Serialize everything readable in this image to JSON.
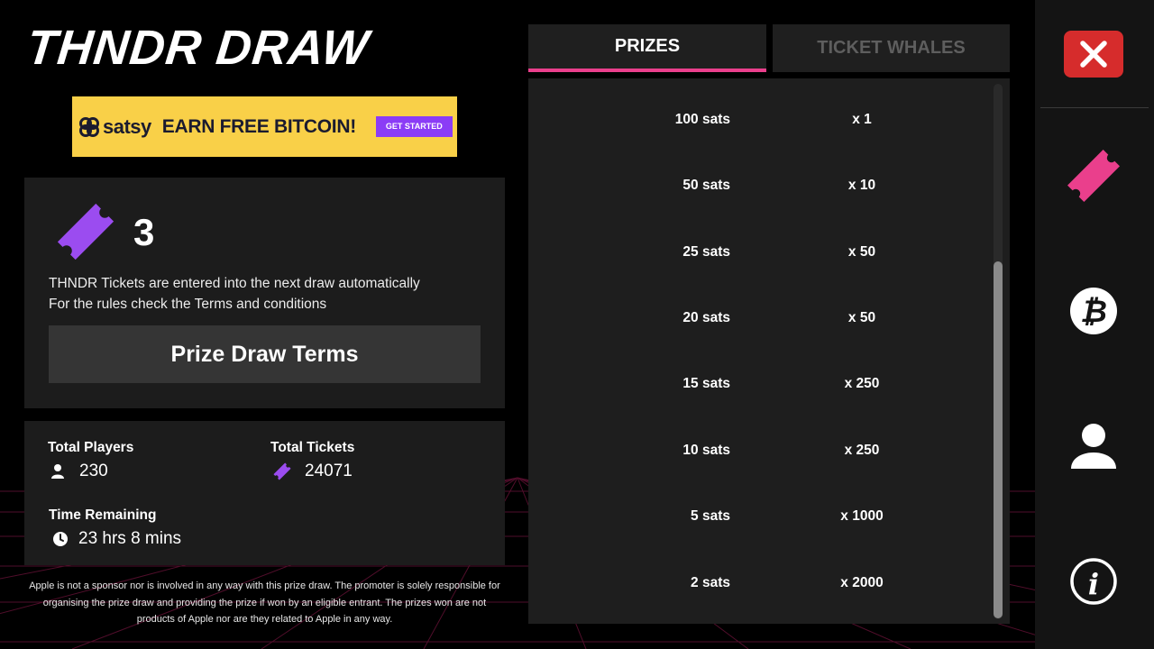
{
  "header": {
    "title": "THNDR DRAW"
  },
  "ad": {
    "brand": "satsy",
    "headline": "EARN FREE BITCOIN!",
    "cta": "GET STARTED"
  },
  "tickets": {
    "count": "3",
    "info_line1": "THNDR Tickets are entered into the next  draw automatically",
    "info_line2": "For the rules check the Terms and conditions",
    "terms_button": "Prize Draw Terms"
  },
  "stats": {
    "players_label": "Total Players",
    "players_value": "230",
    "tickets_label": "Total Tickets",
    "tickets_value": "24071",
    "time_label": "Time Remaining",
    "time_value": "23 hrs 8 mins"
  },
  "disclaimer": "Apple is not a sponsor nor is involved in any way with this prize draw. The promoter is solely responsible for organising the prize draw and providing the prize if won by an eligible entrant. The prizes won are not products of Apple nor are they related to Apple in any way.",
  "tabs": [
    {
      "label": "PRIZES",
      "active": true
    },
    {
      "label": "TICKET WHALES",
      "active": false
    }
  ],
  "prizes": [
    {
      "amount": "100 sats",
      "quantity": "x 1"
    },
    {
      "amount": "50 sats",
      "quantity": "x 10"
    },
    {
      "amount": "25 sats",
      "quantity": "x 50"
    },
    {
      "amount": "20 sats",
      "quantity": "x 50"
    },
    {
      "amount": "15 sats",
      "quantity": "x 250"
    },
    {
      "amount": "10 sats",
      "quantity": "x 250"
    },
    {
      "amount": "5 sats",
      "quantity": "x 1000"
    },
    {
      "amount": "2 sats",
      "quantity": "x 2000"
    }
  ],
  "sidebar": {
    "icons": [
      "close-icon",
      "ticket-icon",
      "bitcoin-icon",
      "user-icon",
      "info-icon"
    ]
  },
  "colors": {
    "accent_pink": "#ea3f8c",
    "ticket_purple": "#9b4cf0",
    "close_red": "#d62c2c",
    "ad_yellow": "#f9d048",
    "panel_bg": "#1c1c1c"
  }
}
